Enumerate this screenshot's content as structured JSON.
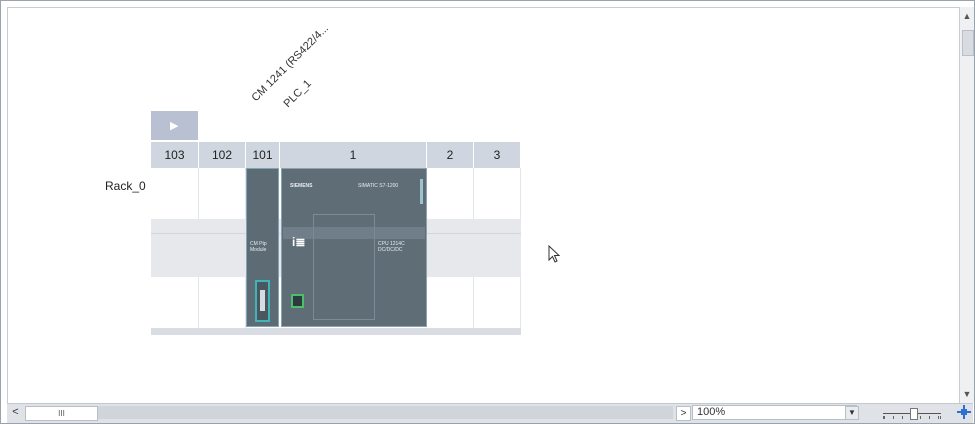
{
  "device_labels": {
    "module_top": "CM 1241 (RS422/4...",
    "module_name": "PLC_1"
  },
  "rack": {
    "name": "Rack_0",
    "expand_glyph": "▶",
    "slots": [
      "103",
      "102",
      "101",
      "1",
      "2",
      "3"
    ]
  },
  "cpu": {
    "brand": "SIEMENS",
    "model_line": "SIMATIC S7-1200",
    "cpu_text": "CPU 1214C DC/DC/DC",
    "logo_glyph": "i≣"
  },
  "cm_module": {
    "text": "CM Ptp Module"
  },
  "statusbar": {
    "scroll_left": "<",
    "scroll_thumb_text": "III",
    "scroll_right": ">",
    "zoom_value": "100%",
    "zoom_dropdown": "▼"
  },
  "colors": {
    "slot_header": "#cfd6e0",
    "module_body": "#5f6d77",
    "serial_port": "#3fb5b7",
    "ethernet_port": "#4bc06b"
  },
  "icons": {
    "cursor": "arrow-cursor-icon",
    "fit": "fit-to-view-icon"
  }
}
